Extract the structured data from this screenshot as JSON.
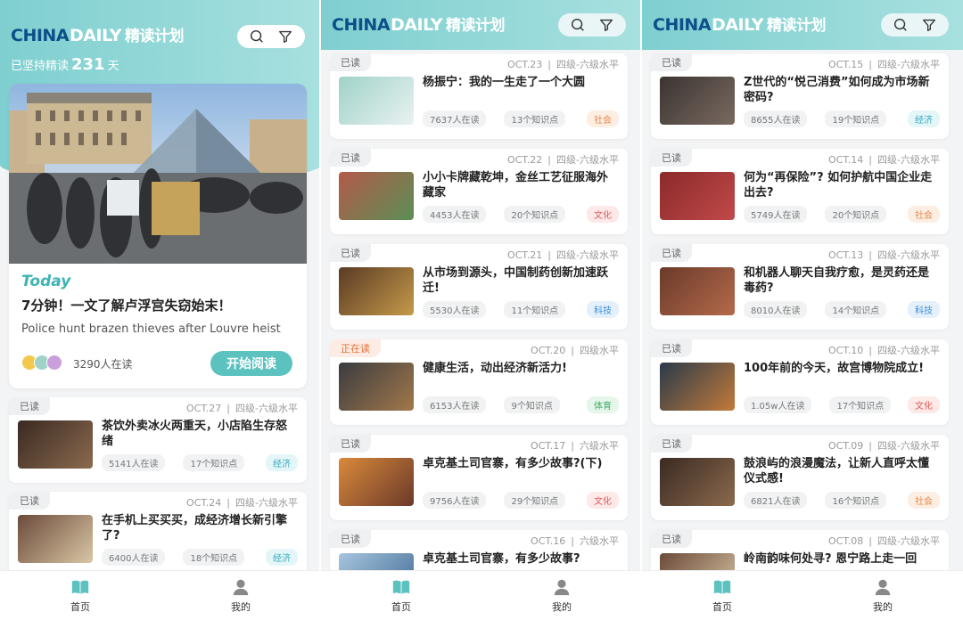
{
  "app": {
    "logo_china": "CHINA",
    "logo_daily": "DAILY",
    "logo_plan": "精读计划",
    "search_icon": "search-icon",
    "filter_icon": "filter-icon"
  },
  "home": {
    "streak_prefix": "已坚持精读",
    "streak_days": "231",
    "streak_suffix": "天",
    "today_label": "Today",
    "hero_title": "7分钟！一文了解卢浮宫失窃始末！",
    "hero_subtitle": "Police hunt brazen thieves after Louvre heist",
    "hero_readers": "3290人在读",
    "start_button": "开始阅读"
  },
  "tabs": [
    {
      "label": "首页",
      "icon": "book-icon"
    },
    {
      "label": "我的",
      "icon": "user-icon"
    }
  ],
  "category_colors": {
    "社会": {
      "fg": "#e58a4b",
      "bg": "#fdeee4"
    },
    "文化": {
      "fg": "#e25a55",
      "bg": "#fde9e8"
    },
    "经济": {
      "fg": "#35aabd",
      "bg": "#e4f6f8"
    },
    "科技": {
      "fg": "#3a8fd6",
      "bg": "#e5f0fb"
    },
    "体育": {
      "fg": "#3fae64",
      "bg": "#e6f6ea"
    }
  },
  "screen1_cards": [
    {
      "status": "已读",
      "date": "OCT.27",
      "level": "四级-六级水平",
      "title": "茶饮外卖冰火两重天，小店陷生存怒绪",
      "readers": "5141人在读",
      "points": "17个知识点",
      "category": "经济"
    },
    {
      "status": "已读",
      "date": "OCT.24",
      "level": "四级-六级水平",
      "title": "在手机上买买买，成经济增长新引擎了?",
      "readers": "6400人在读",
      "points": "18个知识点",
      "category": "经济"
    }
  ],
  "screen2_cards": [
    {
      "status": "已读",
      "date": "OCT.23",
      "level": "四级-六级水平",
      "title": "杨振宁：我的一生走了一个大圆",
      "readers": "7637人在读",
      "points": "13个知识点",
      "category": "社会"
    },
    {
      "status": "已读",
      "date": "OCT.22",
      "level": "四级-六级水平",
      "title": "小小卡牌藏乾坤，金丝工艺征服海外藏家",
      "readers": "4453人在读",
      "points": "20个知识点",
      "category": "文化"
    },
    {
      "status": "已读",
      "date": "OCT.21",
      "level": "四级-六级水平",
      "title": "从市场到源头，中国制药创新加速跃迁!",
      "readers": "5530人在读",
      "points": "11个知识点",
      "category": "科技"
    },
    {
      "status": "正在读",
      "date": "OCT.20",
      "level": "四级水平",
      "title": "健康生活，动出经济新活力!",
      "readers": "6153人在读",
      "points": "9个知识点",
      "category": "体育"
    },
    {
      "status": "已读",
      "date": "OCT.17",
      "level": "六级水平",
      "title": "卓克基土司官寨，有多少故事?(下)",
      "readers": "9756人在读",
      "points": "29个知识点",
      "category": "文化"
    },
    {
      "status": "已读",
      "date": "OCT.16",
      "level": "六级水平",
      "title": "卓克基土司官寨，有多少故事?",
      "readers": "",
      "points": "",
      "category": ""
    }
  ],
  "screen3_cards": [
    {
      "status": "已读",
      "date": "OCT.15",
      "level": "四级-六级水平",
      "title": "Z世代的“悦己消费”如何成为市场新密码?",
      "readers": "8655人在读",
      "points": "19个知识点",
      "category": "经济"
    },
    {
      "status": "已读",
      "date": "OCT.14",
      "level": "四级-六级水平",
      "title": "何为“再保险”? 如何护航中国企业走出去?",
      "readers": "5749人在读",
      "points": "20个知识点",
      "category": "社会"
    },
    {
      "status": "已读",
      "date": "OCT.13",
      "level": "四级-六级水平",
      "title": "和机器人聊天自我疗愈，是灵药还是毒药?",
      "readers": "8010人在读",
      "points": "14个知识点",
      "category": "科技"
    },
    {
      "status": "已读",
      "date": "OCT.10",
      "level": "四级-六级水平",
      "title": "100年前的今天，故宫博物院成立!",
      "readers": "1.05w人在读",
      "points": "17个知识点",
      "category": "文化"
    },
    {
      "status": "已读",
      "date": "OCT.09",
      "level": "四级-六级水平",
      "title": "鼓浪屿的浪漫魔法，让新人直呼太懂仪式感!",
      "readers": "6821人在读",
      "points": "16个知识点",
      "category": "社会"
    },
    {
      "status": "已读",
      "date": "OCT.08",
      "level": "四级-六级水平",
      "title": "岭南韵味何处寻? 恩宁路上走一回",
      "readers": "",
      "points": "",
      "category": ""
    }
  ]
}
